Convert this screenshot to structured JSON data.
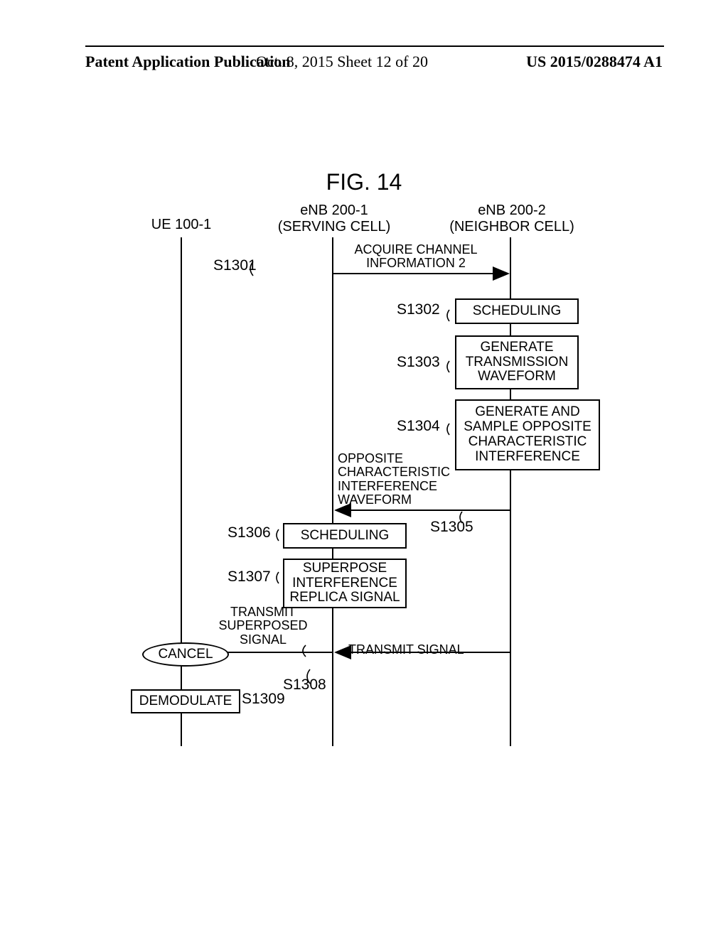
{
  "header": {
    "left": "Patent Application Publication",
    "center": "Oct. 8, 2015   Sheet 12 of 20",
    "right": "US 2015/0288474 A1"
  },
  "figure_title": "FIG. 14",
  "lanes": {
    "ue": {
      "title_l1": "UE 100-1"
    },
    "enb1": {
      "title_l1": "eNB 200-1",
      "title_l2": "(SERVING CELL)"
    },
    "enb2": {
      "title_l1": "eNB 200-2",
      "title_l2": "(NEIGHBOR CELL)"
    }
  },
  "steps": {
    "s1301": {
      "id": "S1301",
      "msg": "ACQUIRE CHANNEL INFORMATION 2"
    },
    "s1302": {
      "id": "S1302",
      "box": "SCHEDULING"
    },
    "s1303": {
      "id": "S1303",
      "box": "GENERATE TRANSMISSION WAVEFORM"
    },
    "s1304": {
      "id": "S1304",
      "box": "GENERATE AND SAMPLE OPPOSITE CHARACTERISTIC INTERFERENCE"
    },
    "s1305": {
      "id": "S1305",
      "msg": "OPPOSITE CHARACTERISTIC INTERFERENCE WAVEFORM"
    },
    "s1306": {
      "id": "S1306",
      "box": "SCHEDULING"
    },
    "s1307": {
      "id": "S1307",
      "box": "SUPERPOSE INTERFERENCE REPLICA SIGNAL"
    },
    "s1308a": {
      "msg": "TRANSMIT SUPERPOSED SIGNAL"
    },
    "s1308": {
      "id": "S1308"
    },
    "s1308b": {
      "msg": "TRANSMIT SIGNAL"
    },
    "cancel": "CANCEL",
    "s1309": {
      "id": "S1309",
      "box": "DEMODULATE"
    }
  },
  "chart_data": {
    "type": "table",
    "description": "Sequence diagram message flow",
    "lanes": [
      "UE 100-1",
      "eNB 200-1 (SERVING CELL)",
      "eNB 200-2 (NEIGHBOR CELL)"
    ],
    "events": [
      {
        "id": "S1301",
        "from": "eNB 200-1",
        "to": "eNB 200-2",
        "label": "ACQUIRE CHANNEL INFORMATION 2",
        "type": "message"
      },
      {
        "id": "S1302",
        "at": "eNB 200-2",
        "label": "SCHEDULING",
        "type": "action"
      },
      {
        "id": "S1303",
        "at": "eNB 200-2",
        "label": "GENERATE TRANSMISSION WAVEFORM",
        "type": "action"
      },
      {
        "id": "S1304",
        "at": "eNB 200-2",
        "label": "GENERATE AND SAMPLE OPPOSITE CHARACTERISTIC INTERFERENCE",
        "type": "action"
      },
      {
        "id": "S1305",
        "from": "eNB 200-2",
        "to": "eNB 200-1",
        "label": "OPPOSITE CHARACTERISTIC INTERFERENCE WAVEFORM",
        "type": "message"
      },
      {
        "id": "S1306",
        "at": "eNB 200-1",
        "label": "SCHEDULING",
        "type": "action"
      },
      {
        "id": "S1307",
        "at": "eNB 200-1",
        "label": "SUPERPOSE INTERFERENCE REPLICA SIGNAL",
        "type": "action"
      },
      {
        "id": "S1308",
        "from": "eNB 200-1",
        "to": "UE 100-1",
        "label": "TRANSMIT SUPERPOSED SIGNAL",
        "type": "message"
      },
      {
        "id": "S1308b",
        "from": "eNB 200-2",
        "to": "UE 100-1",
        "label": "TRANSMIT SIGNAL",
        "type": "message"
      },
      {
        "id": "CANCEL",
        "at": "UE 100-1",
        "label": "CANCEL",
        "type": "state"
      },
      {
        "id": "S1309",
        "at": "UE 100-1",
        "label": "DEMODULATE",
        "type": "action"
      }
    ]
  }
}
